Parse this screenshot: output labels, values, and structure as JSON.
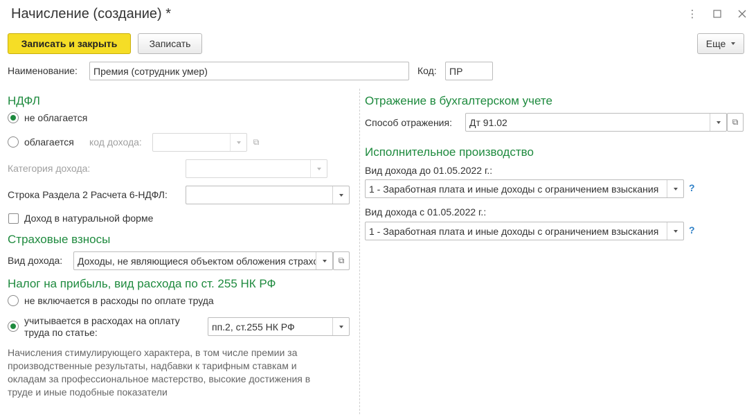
{
  "window": {
    "title": "Начисление (создание) *"
  },
  "toolbar": {
    "save_close_label": "Записать и закрыть",
    "save_label": "Записать",
    "more_label": "Еще"
  },
  "header": {
    "name_label": "Наименование:",
    "name_value": "Премия (сотрудник умер)",
    "code_label": "Код:",
    "code_value": "ПР"
  },
  "ndfl": {
    "title": "НДФЛ",
    "option_not_taxed": "не облагается",
    "option_taxed": "облагается",
    "income_code_label": "код дохода:",
    "income_code_value": "",
    "income_category_label": "Категория дохода:",
    "income_category_value": "",
    "row_6ndfl_label": "Строка Раздела 2 Расчета 6-НДФЛ:",
    "row_6ndfl_value": "",
    "natural_form_label": "Доход в натуральной форме",
    "selected_option": "not_taxed"
  },
  "insurance": {
    "title": "Страховые взносы",
    "income_type_label": "Вид дохода:",
    "income_type_value": "Доходы, не являющиеся объектом обложения страховыми взносами"
  },
  "profit_tax": {
    "title": "Налог на прибыль, вид расхода по ст. 255 НК РФ",
    "option_not_included": "не включается в расходы по оплате труда",
    "option_included": "учитывается в расходах на оплату труда по статье:",
    "article_value": "пп.2, ст.255 НК РФ",
    "selected_option": "included",
    "note": "Начисления стимулирующего характера, в том числе премии за производственные результаты, надбавки к тарифным ставкам и окладам за профессиональное мастерство, высокие достижения в труде и иные подобные показатели"
  },
  "accounting": {
    "title": "Отражение в бухгалтерском учете",
    "method_label": "Способ отражения:",
    "method_value": "Дт 91.02"
  },
  "enforcement": {
    "title": "Исполнительное производство",
    "before_label": "Вид дохода до 01.05.2022 г.:",
    "before_value": "1 - Заработная плата и иные доходы с ограничением взыскания",
    "after_label": "Вид дохода с 01.05.2022 г.:",
    "after_value": "1 - Заработная плата и иные доходы с ограничением взыскания",
    "help_symbol": "?"
  },
  "colors": {
    "section_heading": "#1e8a3e",
    "primary_button": "#f5dd26",
    "help": "#2d7fc7"
  },
  "icons": [
    "more-vert-icon",
    "maximize-icon",
    "close-icon",
    "chevron-down-icon",
    "open-form-icon",
    "help-icon"
  ]
}
